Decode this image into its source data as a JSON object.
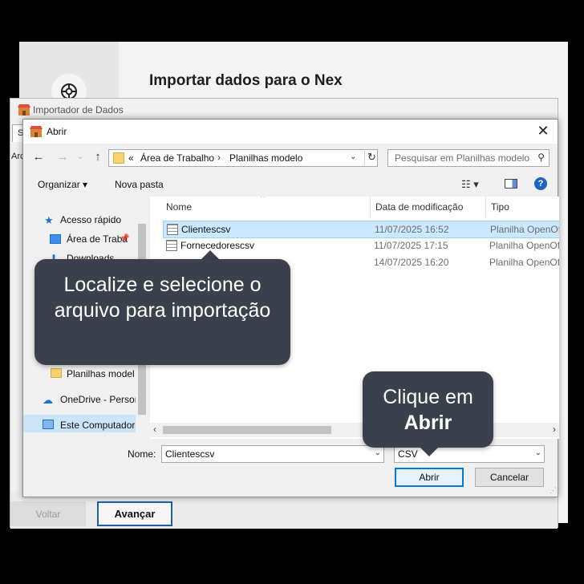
{
  "background_app": {
    "title": "Importar dados para o Nex"
  },
  "importer": {
    "title": "Importador de Dados",
    "tab_fragment": "S",
    "label_fragment": "Arc",
    "back_label": "Voltar",
    "next_label": "Avançar"
  },
  "dialog": {
    "title": "Abrir",
    "address": {
      "overflow": "«",
      "parts": [
        "Área de Trabalho",
        "Planilhas modelo"
      ]
    },
    "search_placeholder": "Pesquisar em Planilhas modelo",
    "toolbar": {
      "organize_label": "Organizar ▾",
      "new_folder_label": "Nova pasta",
      "help": "?"
    },
    "nav_pane": {
      "items": [
        {
          "label": "Acesso rápido",
          "icon": "star-icon"
        },
        {
          "label": "Área de Traba",
          "icon": "desktop-icon"
        },
        {
          "label": "Downloads",
          "icon": "download-icon"
        },
        {
          "label": "Planilhas model",
          "icon": "folder-icon"
        },
        {
          "label": "OneDrive - Persor",
          "icon": "cloud-icon"
        },
        {
          "label": "Este Computador",
          "icon": "computer-icon"
        }
      ]
    },
    "file_list": {
      "columns": [
        "Nome",
        "Data de modificação",
        "Tipo"
      ],
      "rows": [
        {
          "name": "Clientescsv",
          "date": "11/07/2025 16:52",
          "type": "Planilha OpenOf"
        },
        {
          "name": "Fornecedorescsv",
          "date": "11/07/2025 17:15",
          "type": "Planilha OpenOf"
        },
        {
          "name": "",
          "date": "14/07/2025 16:20",
          "type": "Planilha OpenOf"
        }
      ]
    },
    "file_name_label": "Nome:",
    "file_name_value": "Clientescsv",
    "file_type_value": "CSV",
    "open_label": "Abrir",
    "cancel_label": "Cancelar"
  },
  "tooltips": {
    "locate": "Localize e selecione o arquivo para importação",
    "click_prefix": "Clique em",
    "click_bold": "Abrir"
  },
  "colors": {
    "tooltip_bg": "#3a414c",
    "selection": "#cce8ff",
    "primary_border": "#0078d7"
  }
}
